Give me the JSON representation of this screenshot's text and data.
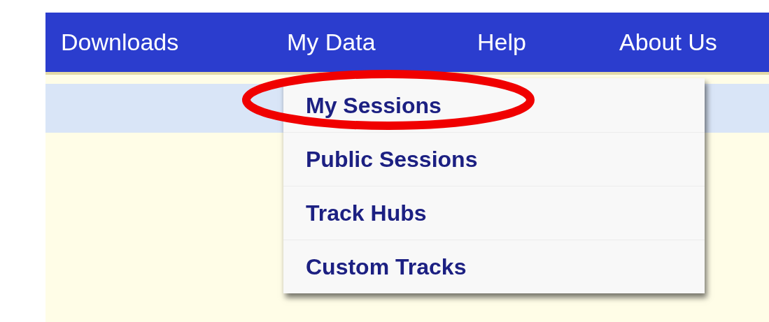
{
  "nav": [
    {
      "label": "Downloads"
    },
    {
      "label": "My Data"
    },
    {
      "label": "Help"
    },
    {
      "label": "About Us"
    }
  ],
  "dropdown": [
    {
      "label": "My Sessions",
      "circled": true
    },
    {
      "label": "Public Sessions",
      "circled": false
    },
    {
      "label": "Track Hubs",
      "circled": false
    },
    {
      "label": "Custom Tracks",
      "circled": false
    }
  ]
}
